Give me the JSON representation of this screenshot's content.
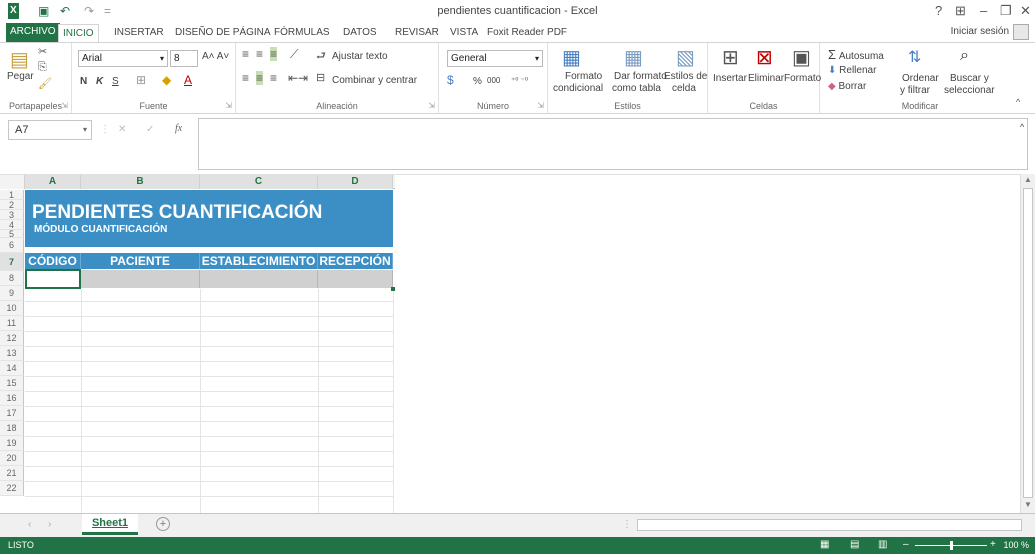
{
  "window": {
    "title": "pendientes cuantificacion - Excel",
    "help": "?",
    "ribbon_display": "⊞",
    "minimize": "–",
    "restore": "❐",
    "close": "✕"
  },
  "quick_access": {
    "excel_logo": "X",
    "save": "💾",
    "undo": "↶",
    "redo": "↷",
    "customize": "="
  },
  "tabs": [
    "ARCHIVO",
    "INICIO",
    "INSERTAR",
    "DISEÑO DE PÁGINA",
    "FÓRMULAS",
    "DATOS",
    "REVISAR",
    "VISTA",
    "Foxit Reader PDF"
  ],
  "account": {
    "signin": "Iniciar sesión"
  },
  "ribbon": {
    "clipboard": {
      "paste": "Pegar",
      "group": "Portapapeles"
    },
    "font": {
      "name": "Arial",
      "size": "8",
      "bold": "N",
      "italic": "K",
      "underline": "S",
      "group": "Fuente"
    },
    "alignment": {
      "wrap": "Ajustar texto",
      "merge": "Combinar y centrar",
      "group": "Alineación"
    },
    "number": {
      "format": "General",
      "percent": "%",
      "thousands": "000",
      "group": "Número"
    },
    "styles": {
      "conditional_1": "Formato",
      "conditional_2": "condicional",
      "table_1": "Dar formato",
      "table_2": "como tabla",
      "cell_1": "Estilos de",
      "cell_2": "celda",
      "group": "Estilos"
    },
    "cells": {
      "insert": "Insertar",
      "delete": "Eliminar",
      "format": "Formato",
      "group": "Celdas"
    },
    "editing": {
      "autosum": "Autosuma",
      "fill": "Rellenar",
      "clear": "Borrar",
      "sort_1": "Ordenar",
      "sort_2": "y filtrar",
      "find_1": "Buscar y",
      "find_2": "seleccionar",
      "group": "Modificar"
    }
  },
  "formula_bar": {
    "name_box": "A7",
    "fx": "fx",
    "cancel": "✕",
    "enter": "✓",
    "content": ""
  },
  "columns": [
    "A",
    "B",
    "C",
    "D"
  ],
  "rows": [
    "1",
    "2",
    "3",
    "4",
    "5",
    "6",
    "7",
    "8",
    "9",
    "10",
    "11",
    "12",
    "13",
    "14",
    "15",
    "16",
    "17",
    "18",
    "19",
    "20",
    "21",
    "22"
  ],
  "sheet": {
    "title": "PENDIENTES CUANTIFICACIÓN",
    "subtitle": "MÓDULO CUANTIFICACIÓN",
    "headers": [
      "CÓDIGO",
      "PACIENTE",
      "ESTABLECIMIENTO",
      "RECEPCIÓN"
    ]
  },
  "sheet_tabs": {
    "active": "Sheet1",
    "add": "+"
  },
  "status": {
    "ready": "LISTO",
    "zoom": "100 %"
  },
  "colors": {
    "excel_green": "#217346",
    "banner_blue": "#3b8fc5"
  }
}
